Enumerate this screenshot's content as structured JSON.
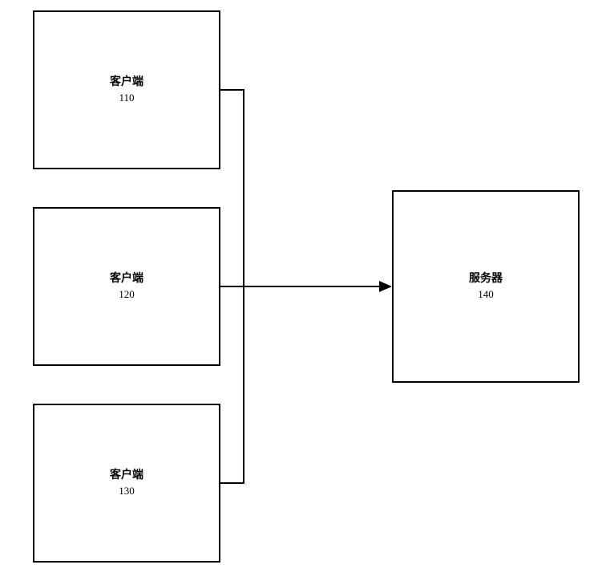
{
  "boxes": {
    "client1": {
      "label": "客户端",
      "number": "110"
    },
    "client2": {
      "label": "客户端",
      "number": "120"
    },
    "client3": {
      "label": "客户端",
      "number": "130"
    },
    "server": {
      "label": "服务器",
      "number": "140"
    }
  }
}
